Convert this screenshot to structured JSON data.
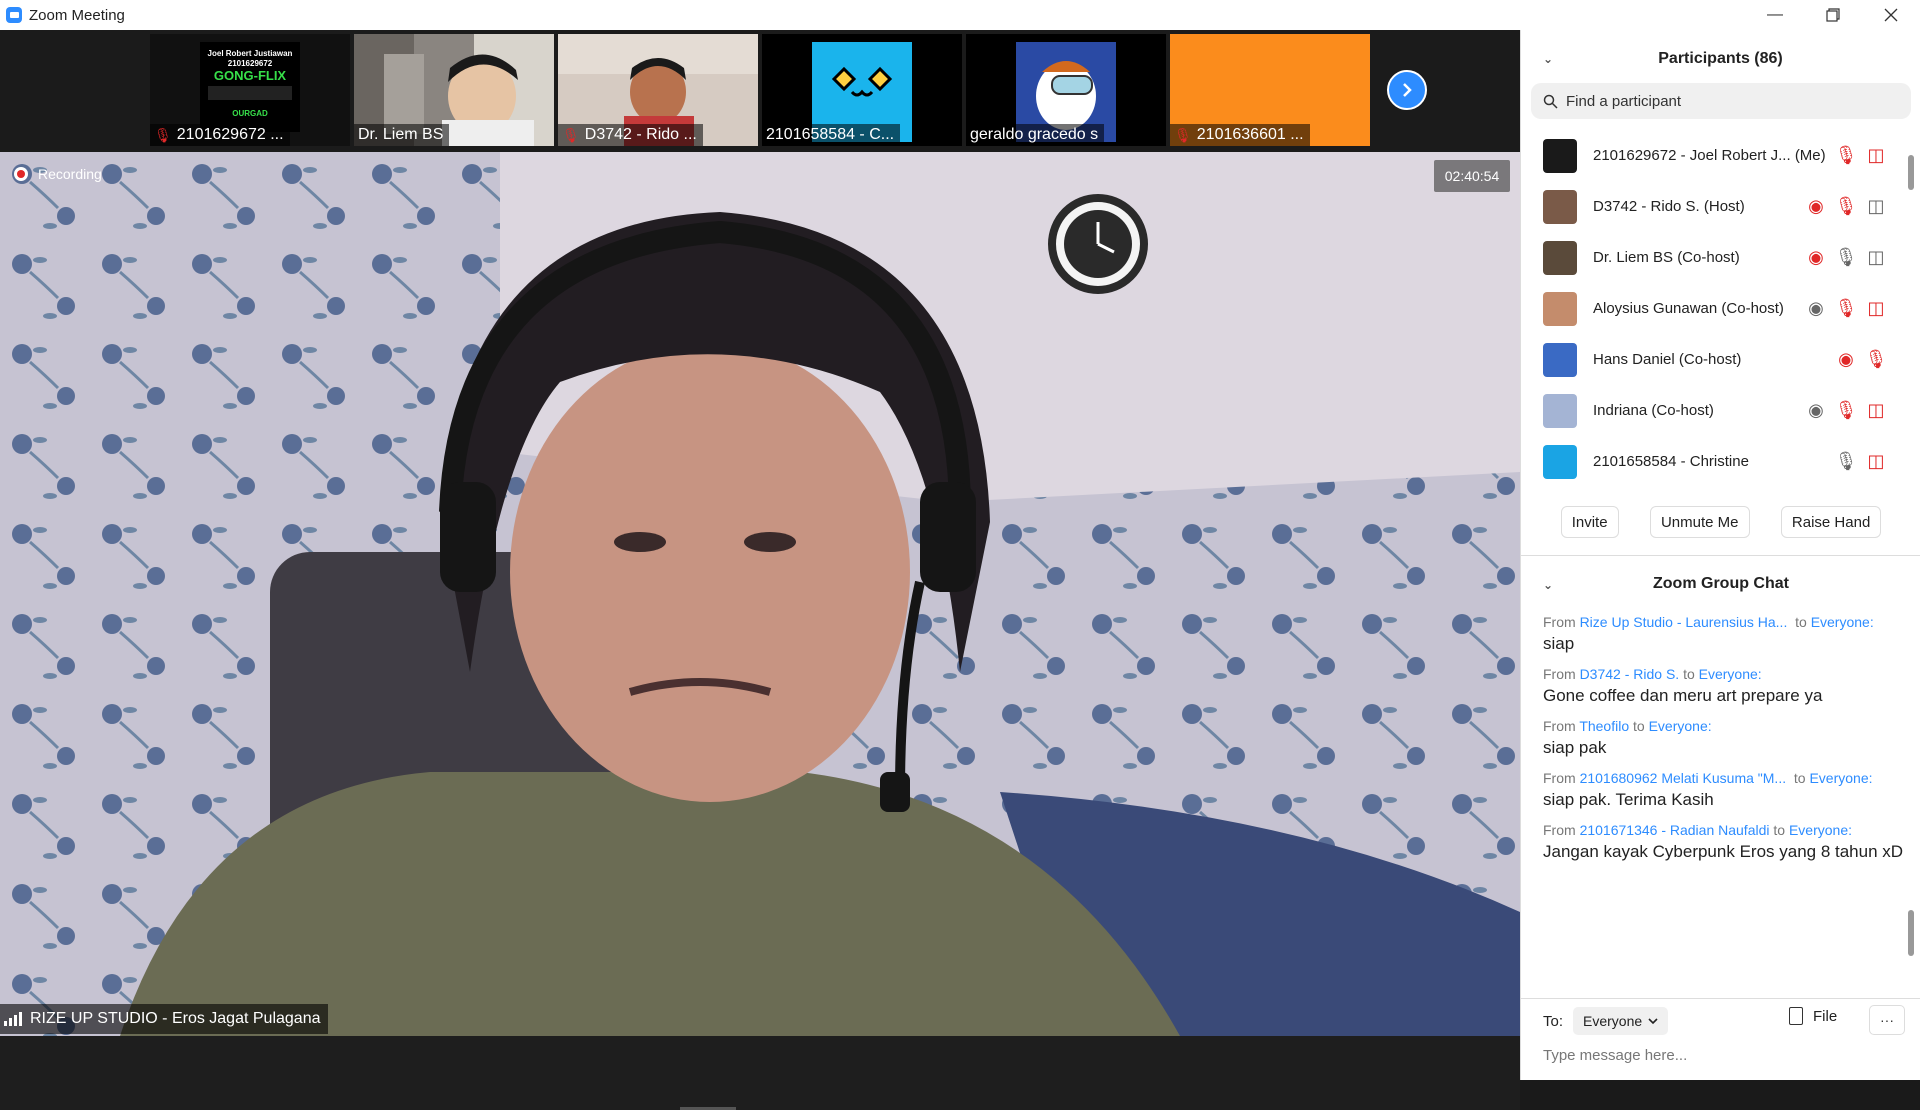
{
  "window": {
    "title": "Zoom Meeting"
  },
  "thumbnails": [
    {
      "name": "2101629672 ...",
      "muted": true,
      "bg": "#111111"
    },
    {
      "name": "Dr. Liem BS",
      "muted": false,
      "bg": "#9a9490"
    },
    {
      "name": "D3742 - Rido ...",
      "muted": true,
      "bg": "#d8ccc4"
    },
    {
      "name": "2101658584 - C...",
      "muted": false,
      "bg": "#000000"
    },
    {
      "name": "geraldo gracedo s",
      "muted": false,
      "bg": "#000000"
    },
    {
      "name": "2101636601 ...",
      "muted": true,
      "bg": "#fb8c1c"
    }
  ],
  "thumbnail_card": {
    "line1": "Joel Robert Justiawan",
    "line2": "2101629672",
    "line3": "GONG-FLIX",
    "line4": "OURGAD"
  },
  "main_video": {
    "recording_label": "Recording",
    "timer": "02:40:54",
    "speaker_name": "RIZE UP STUDIO - Eros Jagat Pulagana"
  },
  "participants": {
    "title": "Participants (86)",
    "search_placeholder": "Find a participant",
    "list": [
      {
        "name": "2101629672 - Joel Robert J...",
        "tag": "(Me)",
        "avatar_color": "#1a1a1a",
        "icons": [
          "mic-muted",
          "cam-off"
        ]
      },
      {
        "name": "D3742 - Rido S. (Host)",
        "tag": "",
        "avatar_color": "#7a5a48",
        "icons": [
          "rec",
          "mic-muted",
          "cam"
        ]
      },
      {
        "name": "Dr. Liem BS (Co-host)",
        "tag": "",
        "avatar_color": "#5a4a3a",
        "icons": [
          "rec",
          "mic",
          "cam"
        ]
      },
      {
        "name": "Aloysius Gunawan (Co-host)",
        "tag": "",
        "avatar_color": "#c48c6c",
        "icons": [
          "rec-grey",
          "mic-muted",
          "cam-off"
        ]
      },
      {
        "name": "Hans Daniel (Co-host)",
        "tag": "",
        "avatar_color": "#3a6ac4",
        "icons": [
          "rec",
          "mic-muted"
        ]
      },
      {
        "name": "Indriana (Co-host)",
        "tag": "",
        "avatar_color": "#a4b4d4",
        "icons": [
          "rec-grey",
          "mic-muted",
          "cam-off"
        ]
      },
      {
        "name": "2101658584 - Christine",
        "tag": "",
        "avatar_color": "#1aa4e4",
        "icons": [
          "mic",
          "cam-off"
        ]
      }
    ],
    "buttons": {
      "invite": "Invite",
      "unmute": "Unmute Me",
      "raise_hand": "Raise Hand"
    }
  },
  "chat": {
    "title": "Zoom Group Chat",
    "messages": [
      {
        "from": "Rize Up Studio - Laurensius Ha...",
        "to": "Everyone:",
        "text": "siap"
      },
      {
        "from": "D3742 - Rido S.",
        "to": "Everyone:",
        "text": "Gone coffee dan meru art prepare ya"
      },
      {
        "from": "Theofilo",
        "to": "Everyone:",
        "text": "siap pak"
      },
      {
        "from": "2101680962 Melati Kusuma \"M...",
        "to": "Everyone:",
        "text": "siap pak. Terima Kasih"
      },
      {
        "from": "2101671346 - Radian Naufaldi",
        "to": "Everyone:",
        "text": "Jangan kayak Cyberpunk Eros yang 8 tahun xD"
      }
    ],
    "from_label": "From",
    "to_word": "to",
    "to_label": "To:",
    "to_value": "Everyone",
    "file_label": "File",
    "more_label": "···",
    "input_placeholder": "Type message here..."
  },
  "colors": {
    "accent": "#2d8cff",
    "muted_red": "#e02828"
  }
}
